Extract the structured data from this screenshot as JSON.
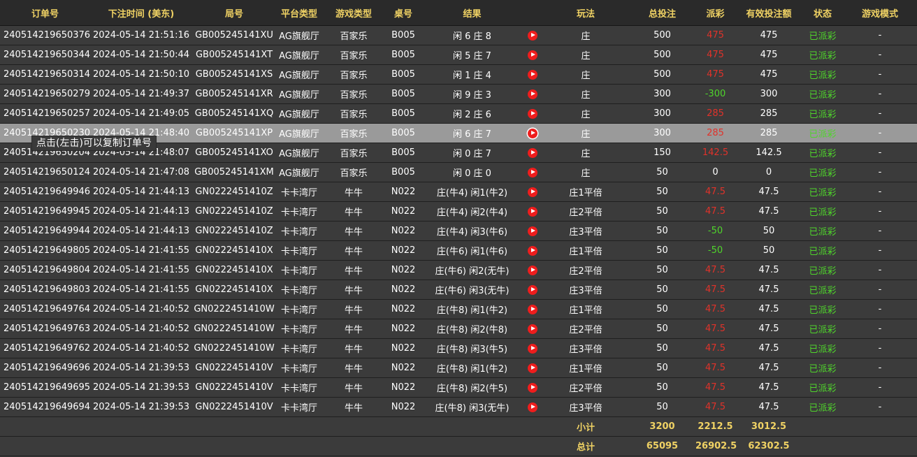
{
  "colors": {
    "header_bg": "#2a2a2a",
    "header_text": "#f0d264",
    "row_bg": "#3b3b3b",
    "highlight_bg": "#9a9a9a",
    "payout_positive": "#e0322a",
    "payout_negative": "#4fd52b",
    "status": "#4fd52b",
    "play_icon": "#ee1d1d"
  },
  "headers": [
    "订单号",
    "下注时间 (美东)",
    "局号",
    "平台类型",
    "游戏类型",
    "桌号",
    "结果",
    "",
    "玩法",
    "总投注",
    "派彩",
    "有效投注额",
    "状态",
    "游戏模式"
  ],
  "rows": [
    {
      "order": "240514219650376",
      "time": "2024-05-14 21:51:16",
      "round": "GB005245141XU",
      "platform": "AG旗舰厅",
      "game": "百家乐",
      "table": "B005",
      "result": "闲 6 庄 8",
      "play": "庄",
      "bet": "500",
      "payout": "475",
      "payout_sign": "pos",
      "valid": "475",
      "status": "已派彩",
      "mode": "-"
    },
    {
      "order": "240514219650344",
      "time": "2024-05-14 21:50:44",
      "round": "GB005245141XT",
      "platform": "AG旗舰厅",
      "game": "百家乐",
      "table": "B005",
      "result": "闲 5 庄 7",
      "play": "庄",
      "bet": "500",
      "payout": "475",
      "payout_sign": "pos",
      "valid": "475",
      "status": "已派彩",
      "mode": "-"
    },
    {
      "order": "240514219650314",
      "time": "2024-05-14 21:50:10",
      "round": "GB005245141XS",
      "platform": "AG旗舰厅",
      "game": "百家乐",
      "table": "B005",
      "result": "闲 1 庄 4",
      "play": "庄",
      "bet": "500",
      "payout": "475",
      "payout_sign": "pos",
      "valid": "475",
      "status": "已派彩",
      "mode": "-"
    },
    {
      "order": "240514219650279",
      "time": "2024-05-14 21:49:37",
      "round": "GB005245141XR",
      "platform": "AG旗舰厅",
      "game": "百家乐",
      "table": "B005",
      "result": "闲 9 庄 3",
      "play": "庄",
      "bet": "300",
      "payout": "-300",
      "payout_sign": "neg",
      "valid": "300",
      "status": "已派彩",
      "mode": "-"
    },
    {
      "order": "240514219650257",
      "time": "2024-05-14 21:49:05",
      "round": "GB005245141XQ",
      "platform": "AG旗舰厅",
      "game": "百家乐",
      "table": "B005",
      "result": "闲 2 庄 6",
      "play": "庄",
      "bet": "300",
      "payout": "285",
      "payout_sign": "pos",
      "valid": "285",
      "status": "已派彩",
      "mode": "-"
    },
    {
      "order": "240514219650230",
      "time": "2024-05-14 21:48:40",
      "round": "GB005245141XP",
      "platform": "AG旗舰厅",
      "game": "百家乐",
      "table": "B005",
      "result": "闲 6 庄 7",
      "play": "庄",
      "bet": "300",
      "payout": "285",
      "payout_sign": "pos",
      "valid": "285",
      "status": "已派彩",
      "mode": "-",
      "highlight": true
    },
    {
      "order": "240514219650204",
      "time": "2024-05-14 21:48:07",
      "round": "GB005245141XO",
      "platform": "AG旗舰厅",
      "game": "百家乐",
      "table": "B005",
      "result": "闲 0 庄 7",
      "play": "庄",
      "bet": "150",
      "payout": "142.5",
      "payout_sign": "pos",
      "valid": "142.5",
      "status": "已派彩",
      "mode": "-"
    },
    {
      "order": "240514219650124",
      "time": "2024-05-14 21:47:08",
      "round": "GB005245141XM",
      "platform": "AG旗舰厅",
      "game": "百家乐",
      "table": "B005",
      "result": "闲 0 庄 0",
      "play": "庄",
      "bet": "50",
      "payout": "0",
      "payout_sign": "zero",
      "valid": "0",
      "status": "已派彩",
      "mode": "-"
    },
    {
      "order": "240514219649946",
      "time": "2024-05-14 21:44:13",
      "round": "GN0222451410Z",
      "platform": "卡卡湾厅",
      "game": "牛牛",
      "table": "N022",
      "result": "庄(牛4) 闲1(牛2)",
      "play": "庄1平倍",
      "bet": "50",
      "payout": "47.5",
      "payout_sign": "pos",
      "valid": "47.5",
      "status": "已派彩",
      "mode": "-"
    },
    {
      "order": "240514219649945",
      "time": "2024-05-14 21:44:13",
      "round": "GN0222451410Z",
      "platform": "卡卡湾厅",
      "game": "牛牛",
      "table": "N022",
      "result": "庄(牛4) 闲2(牛4)",
      "play": "庄2平倍",
      "bet": "50",
      "payout": "47.5",
      "payout_sign": "pos",
      "valid": "47.5",
      "status": "已派彩",
      "mode": "-"
    },
    {
      "order": "240514219649944",
      "time": "2024-05-14 21:44:13",
      "round": "GN0222451410Z",
      "platform": "卡卡湾厅",
      "game": "牛牛",
      "table": "N022",
      "result": "庄(牛4) 闲3(牛6)",
      "play": "庄3平倍",
      "bet": "50",
      "payout": "-50",
      "payout_sign": "neg",
      "valid": "50",
      "status": "已派彩",
      "mode": "-"
    },
    {
      "order": "240514219649805",
      "time": "2024-05-14 21:41:55",
      "round": "GN0222451410X",
      "platform": "卡卡湾厅",
      "game": "牛牛",
      "table": "N022",
      "result": "庄(牛6) 闲1(牛6)",
      "play": "庄1平倍",
      "bet": "50",
      "payout": "-50",
      "payout_sign": "neg",
      "valid": "50",
      "status": "已派彩",
      "mode": "-"
    },
    {
      "order": "240514219649804",
      "time": "2024-05-14 21:41:55",
      "round": "GN0222451410X",
      "platform": "卡卡湾厅",
      "game": "牛牛",
      "table": "N022",
      "result": "庄(牛6) 闲2(无牛)",
      "play": "庄2平倍",
      "bet": "50",
      "payout": "47.5",
      "payout_sign": "pos",
      "valid": "47.5",
      "status": "已派彩",
      "mode": "-"
    },
    {
      "order": "240514219649803",
      "time": "2024-05-14 21:41:55",
      "round": "GN0222451410X",
      "platform": "卡卡湾厅",
      "game": "牛牛",
      "table": "N022",
      "result": "庄(牛6) 闲3(无牛)",
      "play": "庄3平倍",
      "bet": "50",
      "payout": "47.5",
      "payout_sign": "pos",
      "valid": "47.5",
      "status": "已派彩",
      "mode": "-"
    },
    {
      "order": "240514219649764",
      "time": "2024-05-14 21:40:52",
      "round": "GN0222451410W",
      "platform": "卡卡湾厅",
      "game": "牛牛",
      "table": "N022",
      "result": "庄(牛8) 闲1(牛2)",
      "play": "庄1平倍",
      "bet": "50",
      "payout": "47.5",
      "payout_sign": "pos",
      "valid": "47.5",
      "status": "已派彩",
      "mode": "-"
    },
    {
      "order": "240514219649763",
      "time": "2024-05-14 21:40:52",
      "round": "GN0222451410W",
      "platform": "卡卡湾厅",
      "game": "牛牛",
      "table": "N022",
      "result": "庄(牛8) 闲2(牛8)",
      "play": "庄2平倍",
      "bet": "50",
      "payout": "47.5",
      "payout_sign": "pos",
      "valid": "47.5",
      "status": "已派彩",
      "mode": "-"
    },
    {
      "order": "240514219649762",
      "time": "2024-05-14 21:40:52",
      "round": "GN0222451410W",
      "platform": "卡卡湾厅",
      "game": "牛牛",
      "table": "N022",
      "result": "庄(牛8) 闲3(牛5)",
      "play": "庄3平倍",
      "bet": "50",
      "payout": "47.5",
      "payout_sign": "pos",
      "valid": "47.5",
      "status": "已派彩",
      "mode": "-"
    },
    {
      "order": "240514219649696",
      "time": "2024-05-14 21:39:53",
      "round": "GN0222451410V",
      "platform": "卡卡湾厅",
      "game": "牛牛",
      "table": "N022",
      "result": "庄(牛8) 闲1(牛2)",
      "play": "庄1平倍",
      "bet": "50",
      "payout": "47.5",
      "payout_sign": "pos",
      "valid": "47.5",
      "status": "已派彩",
      "mode": "-"
    },
    {
      "order": "240514219649695",
      "time": "2024-05-14 21:39:53",
      "round": "GN0222451410V",
      "platform": "卡卡湾厅",
      "game": "牛牛",
      "table": "N022",
      "result": "庄(牛8) 闲2(牛5)",
      "play": "庄2平倍",
      "bet": "50",
      "payout": "47.5",
      "payout_sign": "pos",
      "valid": "47.5",
      "status": "已派彩",
      "mode": "-"
    },
    {
      "order": "240514219649694",
      "time": "2024-05-14 21:39:53",
      "round": "GN0222451410V",
      "platform": "卡卡湾厅",
      "game": "牛牛",
      "table": "N022",
      "result": "庄(牛8) 闲3(无牛)",
      "play": "庄3平倍",
      "bet": "50",
      "payout": "47.5",
      "payout_sign": "pos",
      "valid": "47.5",
      "status": "已派彩",
      "mode": "-"
    }
  ],
  "subtotal": {
    "label": "小计",
    "bet": "3200",
    "payout": "2212.5",
    "valid": "3012.5"
  },
  "total": {
    "label": "总计",
    "bet": "65095",
    "payout": "26902.5",
    "valid": "62302.5"
  },
  "tooltip": "点击(左击)可以复制订单号"
}
